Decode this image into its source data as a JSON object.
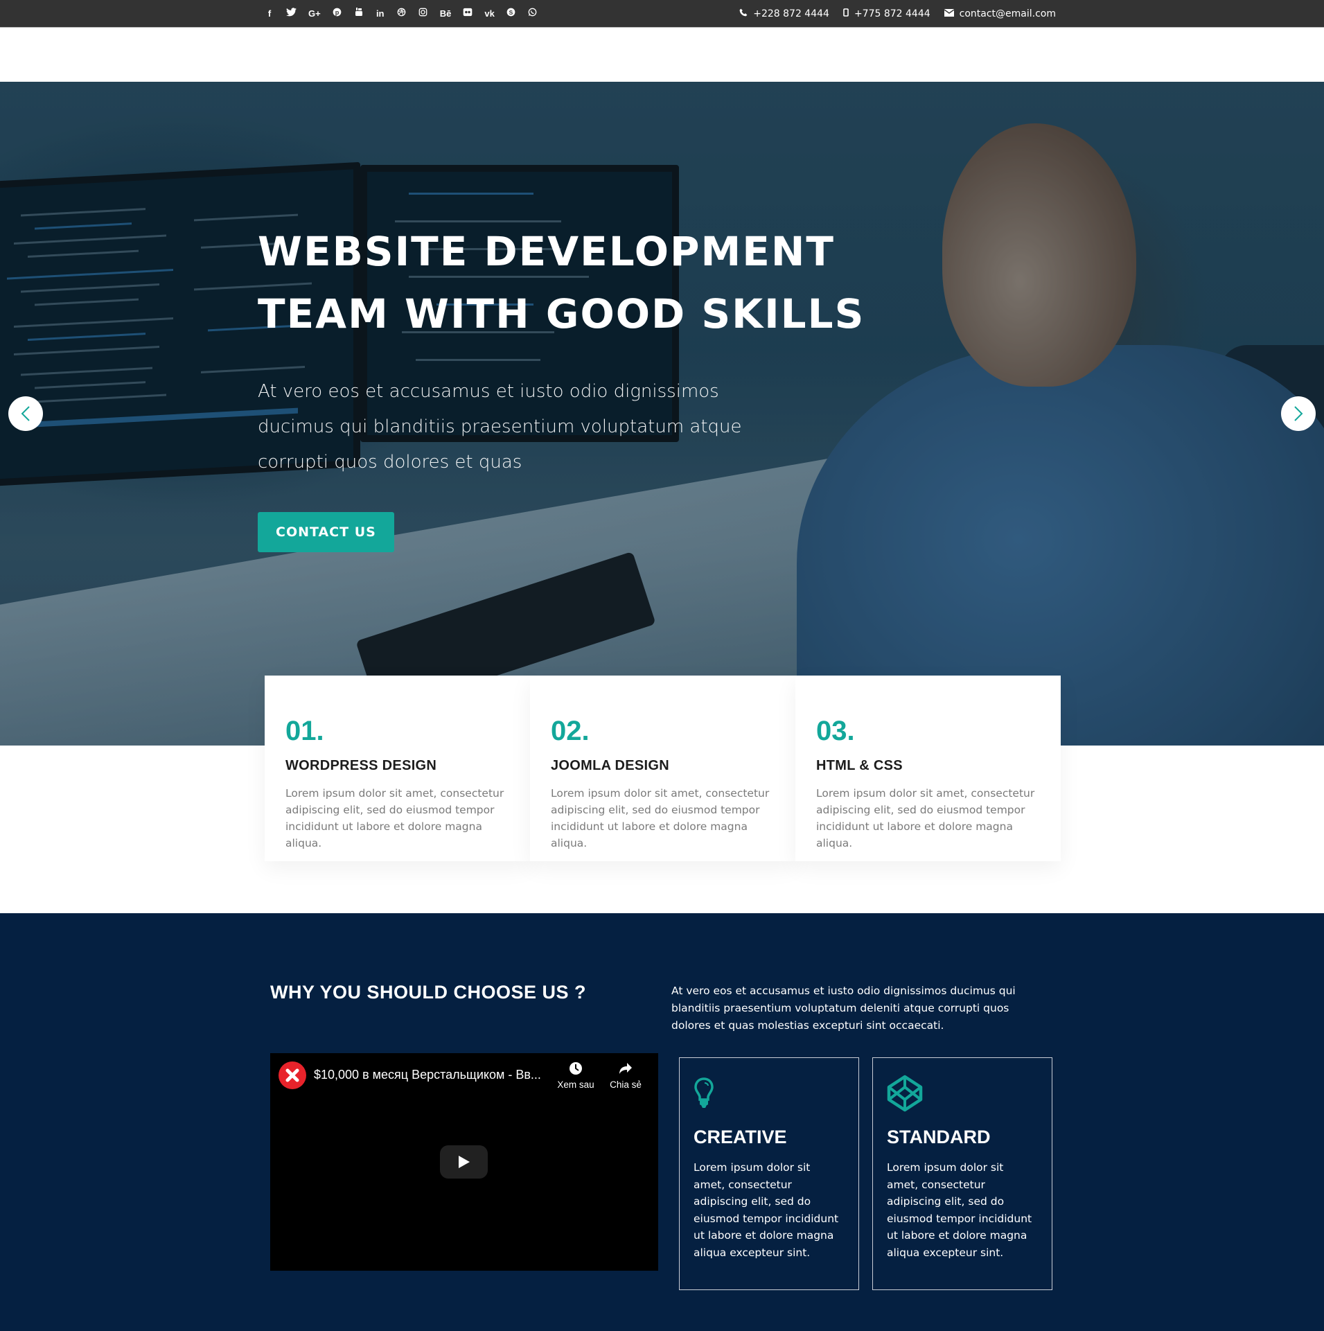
{
  "topbar": {
    "social": [
      {
        "name": "facebook",
        "glyph": "f"
      },
      {
        "name": "twitter",
        "glyph": "🐦"
      },
      {
        "name": "google-plus",
        "glyph": "G+"
      },
      {
        "name": "pinterest",
        "glyph": "℗"
      },
      {
        "name": "youtube",
        "glyph": "▣"
      },
      {
        "name": "linkedin",
        "glyph": "in"
      },
      {
        "name": "dribbble",
        "glyph": "⊛"
      },
      {
        "name": "instagram",
        "glyph": "◎"
      },
      {
        "name": "behance",
        "glyph": "Bē"
      },
      {
        "name": "flickr",
        "glyph": "••"
      },
      {
        "name": "vk",
        "glyph": "vk"
      },
      {
        "name": "skype",
        "glyph": "S"
      },
      {
        "name": "whatsapp",
        "glyph": "✆"
      }
    ],
    "phone": "+228 872 4444",
    "mobile": "+775 872 4444",
    "email": "contact@email.com"
  },
  "hero": {
    "title_line1": "WEBSITE DEVELOPMENT",
    "title_line2": "TEAM WITH GOOD SKILLS",
    "text": "At vero eos et accusamus et iusto odio dignissimos ducimus qui blanditiis praesentium voluptatum atque corrupti quos dolores et quas",
    "cta_label": "CONTACT US",
    "prev_icon": "chevron-left-icon",
    "next_icon": "chevron-right-icon"
  },
  "services": [
    {
      "number": "01.",
      "title": "WORDPRESS DESIGN",
      "text": "Lorem ipsum dolor sit amet, consectetur adipiscing elit, sed do eiusmod tempor incididunt ut labore et dolore magna aliqua."
    },
    {
      "number": "02.",
      "title": "JOOMLA DESIGN",
      "text": "Lorem ipsum dolor sit amet, consectetur adipiscing elit, sed do eiusmod tempor incididunt ut labore et dolore magna aliqua."
    },
    {
      "number": "03.",
      "title": "HTML & CSS",
      "text": "Lorem ipsum dolor sit amet, consectetur adipiscing elit, sed do eiusmod tempor incididunt ut labore et dolore magna aliqua."
    }
  ],
  "why": {
    "title": "WHY YOU SHOULD CHOOSE US ?",
    "text": "At vero eos et accusamus et iusto odio dignissimos ducimus qui blanditiis praesentium voluptatum deleniti atque corrupti quos dolores et quas molestias excepturi sint occaecati.",
    "video": {
      "title": "$10,000 в месяц Верстальщиком - Вв...",
      "watch_later": "Xem sau",
      "share": "Chia sẻ"
    },
    "features": [
      {
        "icon": "lightbulb-icon",
        "title": "CREATIVE",
        "text": "Lorem ipsum dolor sit amet, consectetur adipiscing elit, sed do eiusmod tempor incididunt ut labore et dolore magna aliqua excepteur sint."
      },
      {
        "icon": "codepen-icon",
        "title": "STANDARD",
        "text": "Lorem ipsum dolor sit amet, consectetur adipiscing elit, sed do eiusmod tempor incididunt ut labore et dolore magna aliqua excepteur sint."
      }
    ]
  },
  "colors": {
    "accent": "#13a79a",
    "topbar_bg": "#333333",
    "section_dark": "#052041",
    "heading_dark": "#1c1c1c",
    "body_gray": "#7a7a7a"
  }
}
